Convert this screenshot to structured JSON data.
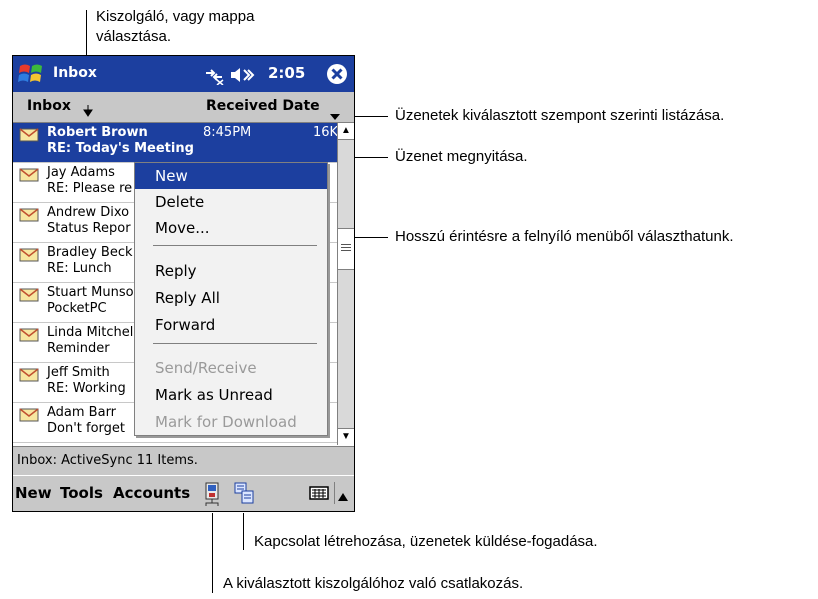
{
  "callouts": {
    "server_line1": "Kiszolgáló, vagy mappa",
    "server_line2": "választása.",
    "sort": "Üzenetek kiválasztott szempont szerinti listázása.",
    "open": "Üzenet megnyitása.",
    "longpress": "Hosszú érintésre a felnyíló menüből választhatunk.",
    "connect": "Kapcsolat létrehozása, üzenetek küldése-fogadása.",
    "server_connect": "A kiválasztott kiszolgálóhoz való csatlakozás."
  },
  "titlebar": {
    "title": "Inbox",
    "clock": "2:05",
    "start_icon": "windows-flag-icon",
    "connectivity_icon": "connectivity-icon",
    "volume_icon": "speaker-icon",
    "close_icon": "close-icon"
  },
  "menubar": {
    "folder_label": "Inbox",
    "sort_label": "Received Date"
  },
  "messages": [
    {
      "sender": "Robert Brown",
      "subject": "RE: Today's Meeting",
      "time": "8:45PM",
      "size": "16K",
      "selected": true
    },
    {
      "sender": "Jay Adams",
      "subject": "RE: Please re"
    },
    {
      "sender": "Andrew Dixo",
      "subject": "Status Repor"
    },
    {
      "sender": "Bradley Beck",
      "subject": "RE: Lunch"
    },
    {
      "sender": "Stuart Munso",
      "subject": "PocketPC"
    },
    {
      "sender": "Linda Mitchel",
      "subject": "Reminder"
    },
    {
      "sender": "Jeff Smith",
      "subject": "RE: Working"
    },
    {
      "sender": "Adam Barr",
      "subject": "Don't forget"
    }
  ],
  "context_menu": {
    "new": "New",
    "delete": "Delete",
    "move": "Move...",
    "reply": "Reply",
    "reply_all": "Reply All",
    "forward": "Forward",
    "send_receive": "Send/Receive",
    "mark_unread": "Mark as Unread",
    "mark_download": "Mark for Download"
  },
  "status": "Inbox: ActiveSync  11 Items.",
  "commandbar": {
    "new": "New",
    "tools": "Tools",
    "accounts": "Accounts"
  },
  "colors": {
    "accent": "#1c3f9f",
    "bar": "#c8c8c8"
  }
}
